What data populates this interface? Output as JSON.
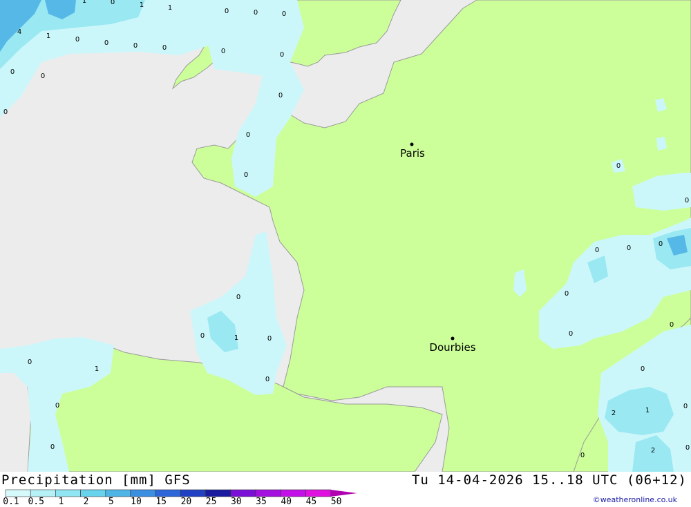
{
  "map": {
    "cities": [
      {
        "name": "Paris"
      },
      {
        "name": "Dourbies"
      }
    ],
    "precip_labels": [
      "1",
      "0",
      "1",
      "1",
      "4",
      "1",
      "0",
      "0",
      "0",
      "0",
      "0",
      "0",
      "0",
      "0",
      "0",
      "0",
      "0",
      "0",
      "0",
      "0",
      "0",
      "0",
      "0",
      "0",
      "0",
      "0",
      "1",
      "0",
      "0",
      "1",
      "0",
      "0",
      "0",
      "0",
      "0",
      "0",
      "0",
      "0",
      "2",
      "1",
      "0",
      "2",
      "0",
      "0",
      "0"
    ],
    "colors": {
      "sea": "#ececec",
      "land": "#ccff99",
      "precip_light": "#ccf7fa",
      "precip_mid": "#99e8f2",
      "precip_heavy": "#55b8e6",
      "border": "#9a9a9a"
    }
  },
  "footer": {
    "title": "Precipitation [mm] GFS",
    "datetime": "Tu 14-04-2026 15..18 UTC (06+12)",
    "credit": "©weatheronline.co.uk"
  },
  "legend": {
    "ticks": [
      "0.1",
      "0.5",
      "1",
      "2",
      "5",
      "10",
      "15",
      "20",
      "25",
      "30",
      "35",
      "40",
      "45",
      "50"
    ],
    "colors": [
      "#d6fafc",
      "#b5f1f7",
      "#8fe5f1",
      "#67d3ec",
      "#4fb5e6",
      "#3a8fe0",
      "#2c66d8",
      "#2141c4",
      "#1a1aa0",
      "#7a10d8",
      "#a410e0",
      "#c410e8",
      "#e010e0",
      "#b000b0"
    ]
  }
}
